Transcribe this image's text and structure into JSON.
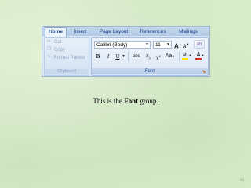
{
  "ribbon": {
    "tabs": [
      "Home",
      "Insert",
      "Page Layout",
      "References",
      "Mailings"
    ],
    "clipboard": {
      "items": [
        {
          "label": "Cut",
          "icon": "scissors-icon"
        },
        {
          "label": "Copy",
          "icon": "copy-icon"
        },
        {
          "label": "Format Painter",
          "icon": "format-painter-icon"
        }
      ],
      "group_label": "Clipboard"
    },
    "font_group": {
      "font_name": "Calibri (Body)",
      "font_size": "11",
      "group_label": "Font",
      "buttons": {
        "grow": "A",
        "shrink": "A",
        "clear": "ab",
        "bold": "B",
        "italic": "I",
        "underline": "U",
        "strikethrough": "abe",
        "subscript": "x",
        "superscript": "x",
        "change_case": "Aa",
        "highlight": "ab",
        "font_color": "A"
      }
    }
  },
  "caption": {
    "prefix": "This is the ",
    "bold": "Font",
    "suffix": " group."
  },
  "slide_number": "63",
  "colors": {
    "background": "#d9ecc9",
    "ribbon_text": "#15428b",
    "highlight": "#ffe800",
    "font_color": "#e0261b"
  }
}
